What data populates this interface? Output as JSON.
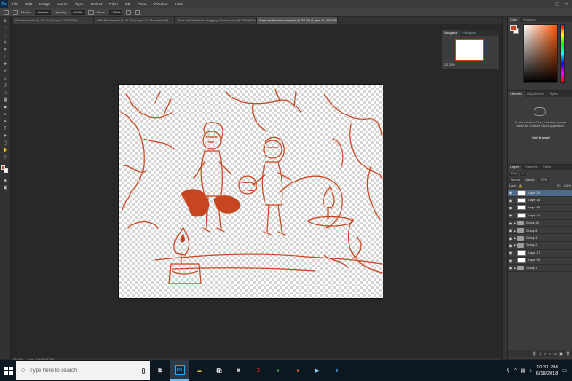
{
  "app": {
    "logo": "Ps",
    "accent": "#31a8ff",
    "drawing_color": "#c8461f"
  },
  "menu": [
    "File",
    "Edit",
    "Image",
    "Layer",
    "Type",
    "Select",
    "Filter",
    "3D",
    "View",
    "Window",
    "Help"
  ],
  "window_controls": [
    "–",
    "▢",
    "✕"
  ],
  "options_bar": {
    "mode_label": "Mode:",
    "mode_value": "Normal",
    "opacity_label": "Opacity:",
    "opacity_value": "100%",
    "flow_label": "Flow:",
    "flow_value": "100%"
  },
  "tabs": [
    {
      "label": "Flowerina.psd @ 16.7% (Group 2, RGB/8#)"
    },
    {
      "label": "With Minnie.psd @ 16.7% (Layer 12, Illustration/8)"
    },
    {
      "label": "Kate and Madeline Hugging Shadow.psd @ 25% (Silhouette/8)"
    },
    {
      "label": "Kaya and Islamouche.psd @ 33.3% (Layer 18, RGB/8*)",
      "active": true
    }
  ],
  "status": {
    "zoom": "33.33%",
    "doc": "Doc: 15.4M/286.2M"
  },
  "navigator": {
    "tabs": [
      "Navigator",
      "Histogram"
    ],
    "zoom": "33.33%"
  },
  "color_panel": {
    "tabs": [
      "Color",
      "Swatches"
    ],
    "foreground": "#c8461f",
    "background": "#ffffff"
  },
  "libraries": {
    "tabs": [
      "Libraries",
      "Adjustments",
      "Styles"
    ],
    "message": "To use Creative Cloud Libraries, please install the Creative Cloud Application.",
    "link": "Get it now!"
  },
  "layers": {
    "tabs": [
      "Layers",
      "Channels",
      "Paths"
    ],
    "filter": [
      "Kind",
      "▾"
    ],
    "blend": "Normal",
    "opacity_label": "Opacity:",
    "opacity_value": "100%",
    "lock_label": "Lock:",
    "fill_label": "Fill:",
    "fill_value": "100%",
    "rows": [
      {
        "name": "Layer 19",
        "type": "layer",
        "selected": true
      },
      {
        "name": "Layer 18",
        "type": "layer"
      },
      {
        "name": "Layer 15",
        "type": "layer"
      },
      {
        "name": "Layer 14",
        "type": "layer"
      },
      {
        "name": "Group 10",
        "type": "group"
      },
      {
        "name": "Group 8",
        "type": "group"
      },
      {
        "name": "Group 4",
        "type": "group"
      },
      {
        "name": "Group 2",
        "type": "group"
      },
      {
        "name": "Layer 17",
        "type": "layer"
      },
      {
        "name": "Layer 16",
        "type": "layer"
      },
      {
        "name": "Group 1",
        "type": "group"
      }
    ],
    "footer_icons": [
      "link-icon",
      "fx-icon",
      "mask-icon",
      "adjustment-icon",
      "folder-icon",
      "new-layer-icon",
      "trash-icon"
    ]
  },
  "taskbar": {
    "search_placeholder": "Type here to search",
    "apps": [
      {
        "name": "task-view",
        "glyph": "⧉",
        "color": "#ffffff"
      },
      {
        "name": "photoshop",
        "glyph": "Ps",
        "color": "#31a8ff",
        "active": true
      },
      {
        "name": "file-explorer",
        "glyph": "▬",
        "color": "#f4c542"
      },
      {
        "name": "store",
        "glyph": "🛍",
        "color": "#ffffff"
      },
      {
        "name": "mail",
        "glyph": "✉",
        "color": "#ffffff"
      },
      {
        "name": "opera",
        "glyph": "O",
        "color": "#ff1b2d"
      },
      {
        "name": "chrome",
        "glyph": "●",
        "color": "#4caf50"
      },
      {
        "name": "firefox",
        "glyph": "●",
        "color": "#ff7139"
      },
      {
        "name": "media",
        "glyph": "▶",
        "color": "#8fd3ff"
      },
      {
        "name": "ie",
        "glyph": "e",
        "color": "#49a5f5"
      }
    ],
    "time": "10:31 PM",
    "date": "6/18/2018"
  }
}
